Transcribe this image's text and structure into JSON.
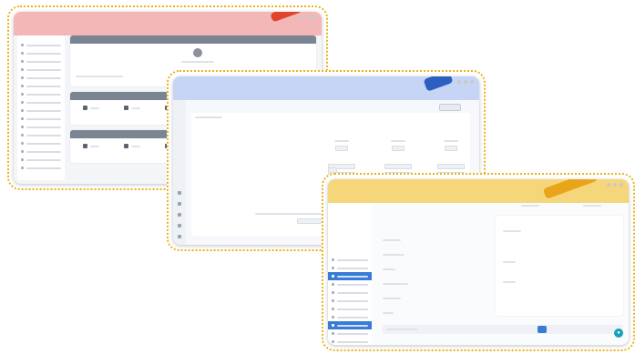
{
  "page": {
    "title": "",
    "note": ""
  },
  "screenshots": [
    {
      "id": "dashboard",
      "window_title": "",
      "sections": [
        {
          "label": ""
        },
        {
          "label": ""
        },
        {
          "label": ""
        },
        {
          "label": ""
        }
      ]
    },
    {
      "id": "configuration",
      "window_title": "",
      "sections": [
        {
          "label": ""
        },
        {
          "label": ""
        }
      ]
    },
    {
      "id": "settings",
      "window_title": "",
      "sections": [
        {
          "label": ""
        }
      ]
    }
  ],
  "colors": {
    "border_dotted": "#e9b21c",
    "dashboard_titlebar": "#f3b7b7",
    "dashboard_accent": "#e0452b",
    "config_titlebar": "#c6d4f5",
    "config_accent": "#2c5fbf",
    "settings_titlebar": "#f5d67a",
    "settings_accent": "#e9a51a",
    "fab": "#17a2b8",
    "sidebar_active": "#3a7bd5"
  },
  "icons": {
    "fab": "chat-bubble-icon",
    "window_controls": "window-control-dots-icon"
  }
}
